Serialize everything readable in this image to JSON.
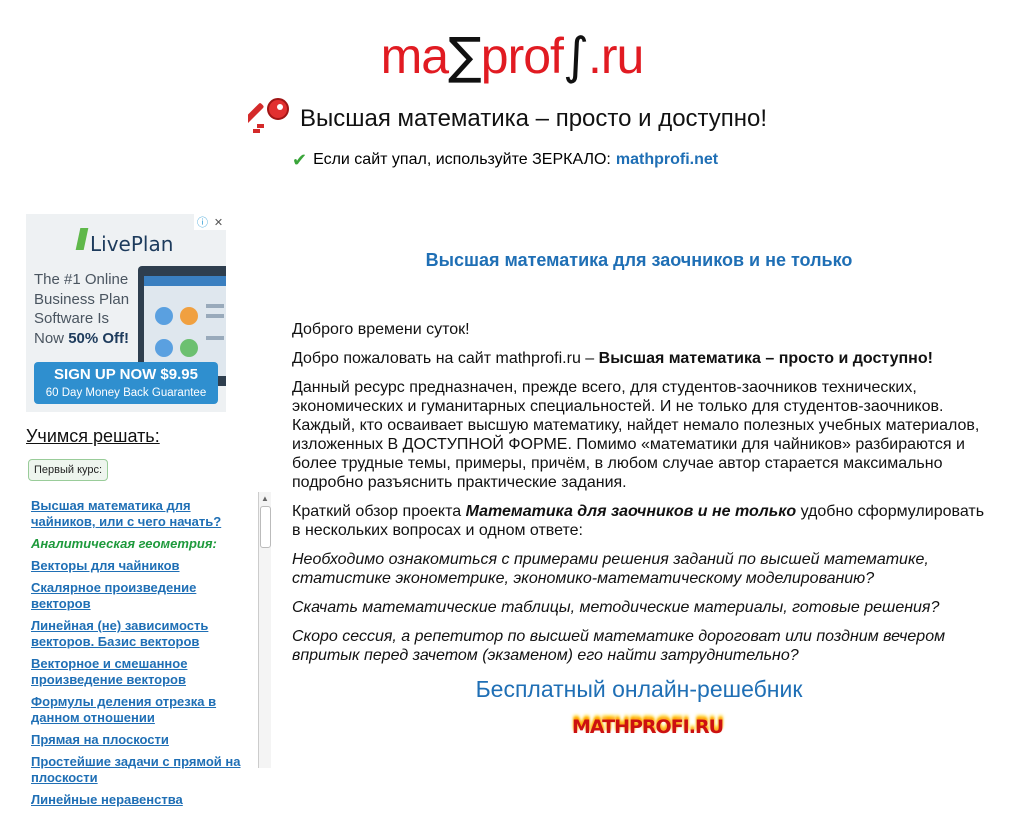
{
  "header": {
    "logo": {
      "part1": "ma",
      "sigma": "∑",
      "part2": "prof",
      "integral": "∫",
      "part3": ".ru"
    },
    "tagline": "Высшая математика – просто и доступно!",
    "mirror_text": "Если сайт упал, используйте ЗЕРКАЛО:",
    "mirror_link": "mathprofi.net",
    "key_icon": "key-icon",
    "check_icon": "checkmark-icon"
  },
  "ad": {
    "brand": "LivePlan",
    "headline_line1": "The #1 Online",
    "headline_line2": "Business Plan",
    "headline_line3": "Software Is",
    "headline_now": "Now ",
    "headline_offer": "50% Off!",
    "cta_main": "SIGN UP NOW $9.95",
    "cta_sub": "60 Day Money Back Guarantee",
    "adchoices_icons": [
      "info-icon",
      "close-icon"
    ]
  },
  "sidebar": {
    "title": "Учимся решать:",
    "course_button": "Первый курс:",
    "nav": [
      {
        "type": "link",
        "label": "Высшая математика для чайников, или с чего начать?"
      },
      {
        "type": "section",
        "label": "Аналитическая геометрия:"
      },
      {
        "type": "link",
        "label": "Векторы для чайников"
      },
      {
        "type": "link",
        "label": "Скалярное произведение векторов"
      },
      {
        "type": "link",
        "label": "Линейная (не) зависимость векторов. Базис векторов"
      },
      {
        "type": "link",
        "label": "Векторное и смешанное произведение векторов"
      },
      {
        "type": "link",
        "label": "Формулы деления отрезка в данном отношении"
      },
      {
        "type": "link",
        "label": "Прямая на плоскости"
      },
      {
        "type": "link",
        "label": "Простейшие задачи с прямой на плоскости"
      },
      {
        "type": "link",
        "label": "Линейные неравенства"
      }
    ]
  },
  "main": {
    "title": "Высшая математика для заочников и не только",
    "greeting": "Доброго времени суток!",
    "welcome_prefix": "Добро пожаловать на сайт mathprofi.ru – ",
    "welcome_bold": "Высшая математика – просто и доступно!",
    "para1": "Данный ресурс предназначен, прежде всего, для студентов-заочников технических, экономических и гуманитарных специальностей. И не только для студентов-заочников. Каждый, кто осваивает высшую математику, найдет немало полезных учебных материалов, изложенных В ДОСТУПНОЙ ФОРМЕ. Помимо «математики для чайников» разбираются и более трудные темы, примеры, причём, в любом случае автор старается максимально подробно разъяснить практические задания.",
    "para2_prefix": "Краткий обзор проекта ",
    "para2_bold": "Математика для заочников и не только",
    "para2_suffix": " удобно сформулировать в нескольких вопросах и одном ответе:",
    "q1": "Необходимо ознакомиться с  примерами решения заданий по высшей математике, статистике эконометрике, экономико-математическому моделированию?",
    "q2": "Скачать математические таблицы, методические материалы, готовые решения?",
    "q3": "Скоро сессия, а репетитор по высшей математике дороговат или поздним вечером впритык перед зачетом (экзаменом) его найти затруднительно?",
    "solver_link": "Бесплатный онлайн-решебник",
    "solver_logo": "MATHPROFI.RU"
  },
  "colors": {
    "logo_red": "#e11b22",
    "link_blue": "#1f6fb5",
    "section_green": "#1e9a3c"
  }
}
